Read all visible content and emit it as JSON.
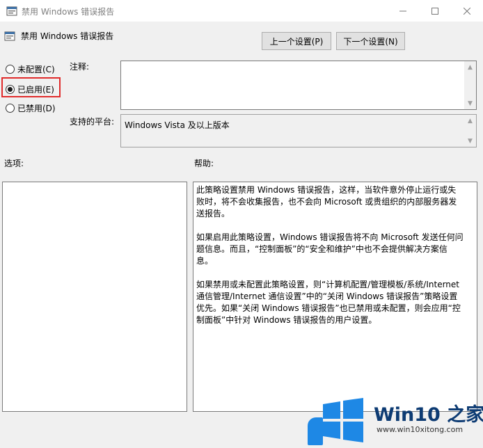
{
  "window": {
    "title": "禁用 Windows 错误报告",
    "icon": "policy-settings-icon",
    "controls": [
      "minimize-icon",
      "maximize-icon",
      "close-icon"
    ]
  },
  "policy": {
    "title": "禁用 Windows 错误报告",
    "prev_label": "上一个设置(P)",
    "next_label": "下一个设置(N)"
  },
  "state": {
    "options": [
      {
        "label": "未配置(C)",
        "checked": false
      },
      {
        "label": "已启用(E)",
        "checked": true
      },
      {
        "label": "已禁用(D)",
        "checked": false
      }
    ],
    "highlight_color": "#e02a2a"
  },
  "labels": {
    "comment": "注释:",
    "platform": "支持的平台:",
    "options": "选项:",
    "help": "帮助:"
  },
  "platform_value": "Windows Vista 及以上版本",
  "comment_value": "",
  "help_paragraphs": [
    "此策略设置禁用 Windows 错误报告，这样，当软件意外停止运行或失败时，将不会收集报告，也不会向 Microsoft 或贵组织的内部服务器发送报告。",
    "如果启用此策略设置，Windows 错误报告将不向 Microsoft 发送任何问题信息。而且，“控制面板”的“安全和维护”中也不会提供解决方案信息。",
    "如果禁用或未配置此策略设置，则“计算机配置/管理模板/系统/Internet 通信管理/Internet 通信设置”中的“关闭 Windows 错误报告”策略设置优先。如果“关闭 Windows 错误报告”也已禁用或未配置，则会应用“控制面板”中针对 Windows 错误报告的用户设置。"
  ],
  "watermark": {
    "brand": "Win10 之家",
    "url": "www.win10xitong.com",
    "colors": {
      "logo": "#1e88e5",
      "text": "#0d3b73"
    }
  }
}
